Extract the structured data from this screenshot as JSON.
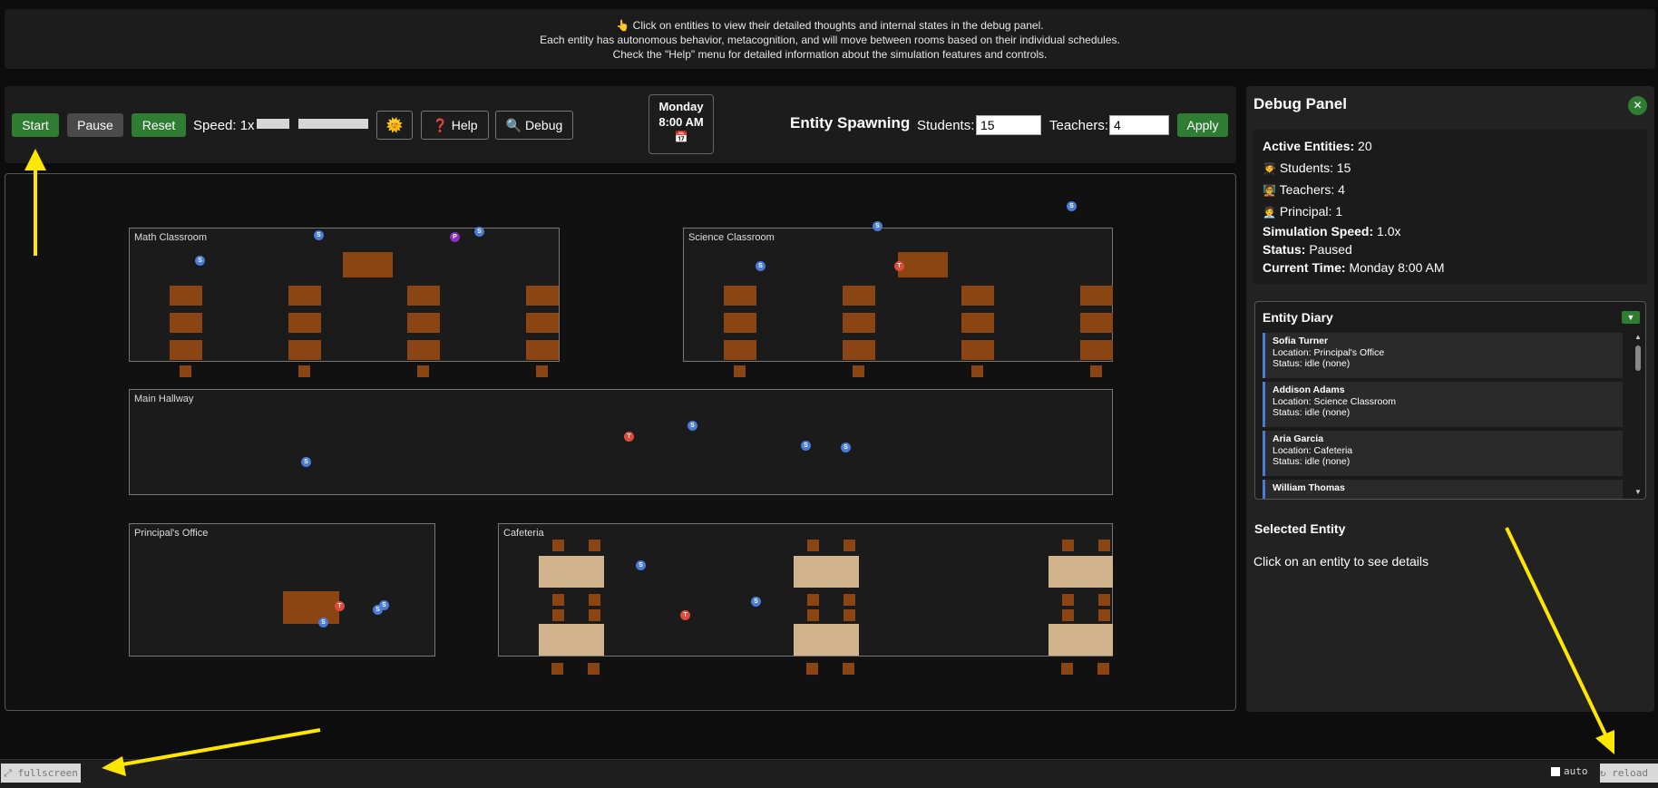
{
  "banner": {
    "line1": "👆 Click on entities to view their detailed thoughts and internal states in the debug panel.",
    "line2": "Each entity has autonomous behavior, metacognition, and will move between rooms based on their individual schedules.",
    "line3": "Check the \"Help\" menu for detailed information about the simulation features and controls."
  },
  "toolbar": {
    "start_label": "Start",
    "pause_label": "Pause",
    "reset_label": "Reset",
    "speed_label": "Speed: 1x",
    "help_label": "Help",
    "help_icon": "❓",
    "debug_label": "Debug",
    "debug_icon": "🔍",
    "theme_icon": "🌞",
    "date_day": "Monday",
    "date_time": "8:00 AM",
    "calendar_icon": "📅",
    "spawning_title": "Entity Spawning",
    "students_label": "Students:",
    "students_value": "15",
    "teachers_label": "Teachers:",
    "teachers_value": "4",
    "apply_label": "Apply"
  },
  "rooms": {
    "math": "Math Classroom",
    "science": "Science Classroom",
    "hallway": "Main Hallway",
    "principal": "Principal's Office",
    "cafeteria": "Cafeteria"
  },
  "entity_letters": {
    "student": "S",
    "teacher": "T",
    "principal": "P"
  },
  "panel": {
    "title": "Debug Panel",
    "close_icon": "✕",
    "active_label": "Active Entities:",
    "active_value": "20",
    "students_icon": "🧑‍🎓",
    "students_text": "Students: 15",
    "teachers_icon": "🧑‍🏫",
    "teachers_text": "Teachers: 4",
    "principal_icon": "🧑‍💼",
    "principal_text": "Principal: 1",
    "speed_label": "Simulation Speed:",
    "speed_value": "1.0x",
    "status_label": "Status:",
    "status_value": "Paused",
    "time_label": "Current Time:",
    "time_value": "Monday 8:00 AM",
    "diary_title": "Entity Diary",
    "diary_toggle_icon": "▼",
    "diary": [
      {
        "name": "Sofia Turner",
        "location": "Location: Principal's Office",
        "status": "Status: idle (none)"
      },
      {
        "name": "Addison Adams",
        "location": "Location: Science Classroom",
        "status": "Status: idle (none)"
      },
      {
        "name": "Aria Garcia",
        "location": "Location: Cafeteria",
        "status": "Status: idle (none)"
      },
      {
        "name": "William Thomas",
        "location": "",
        "status": ""
      }
    ],
    "selected_title": "Selected Entity",
    "selected_hint": "Click on an entity to see details"
  },
  "footer": {
    "fullscreen_label": "⤢ fullscreen",
    "auto_label": "auto",
    "reload_label": "↻ reload"
  },
  "colors": {
    "accent_green": "#2e7d32",
    "desk": "#8a4513",
    "table": "#d2b48c",
    "student": "#4a7bd8",
    "teacher": "#e04a3a",
    "principal": "#8e2ec2",
    "annotation_arrow": "#ffe600"
  }
}
